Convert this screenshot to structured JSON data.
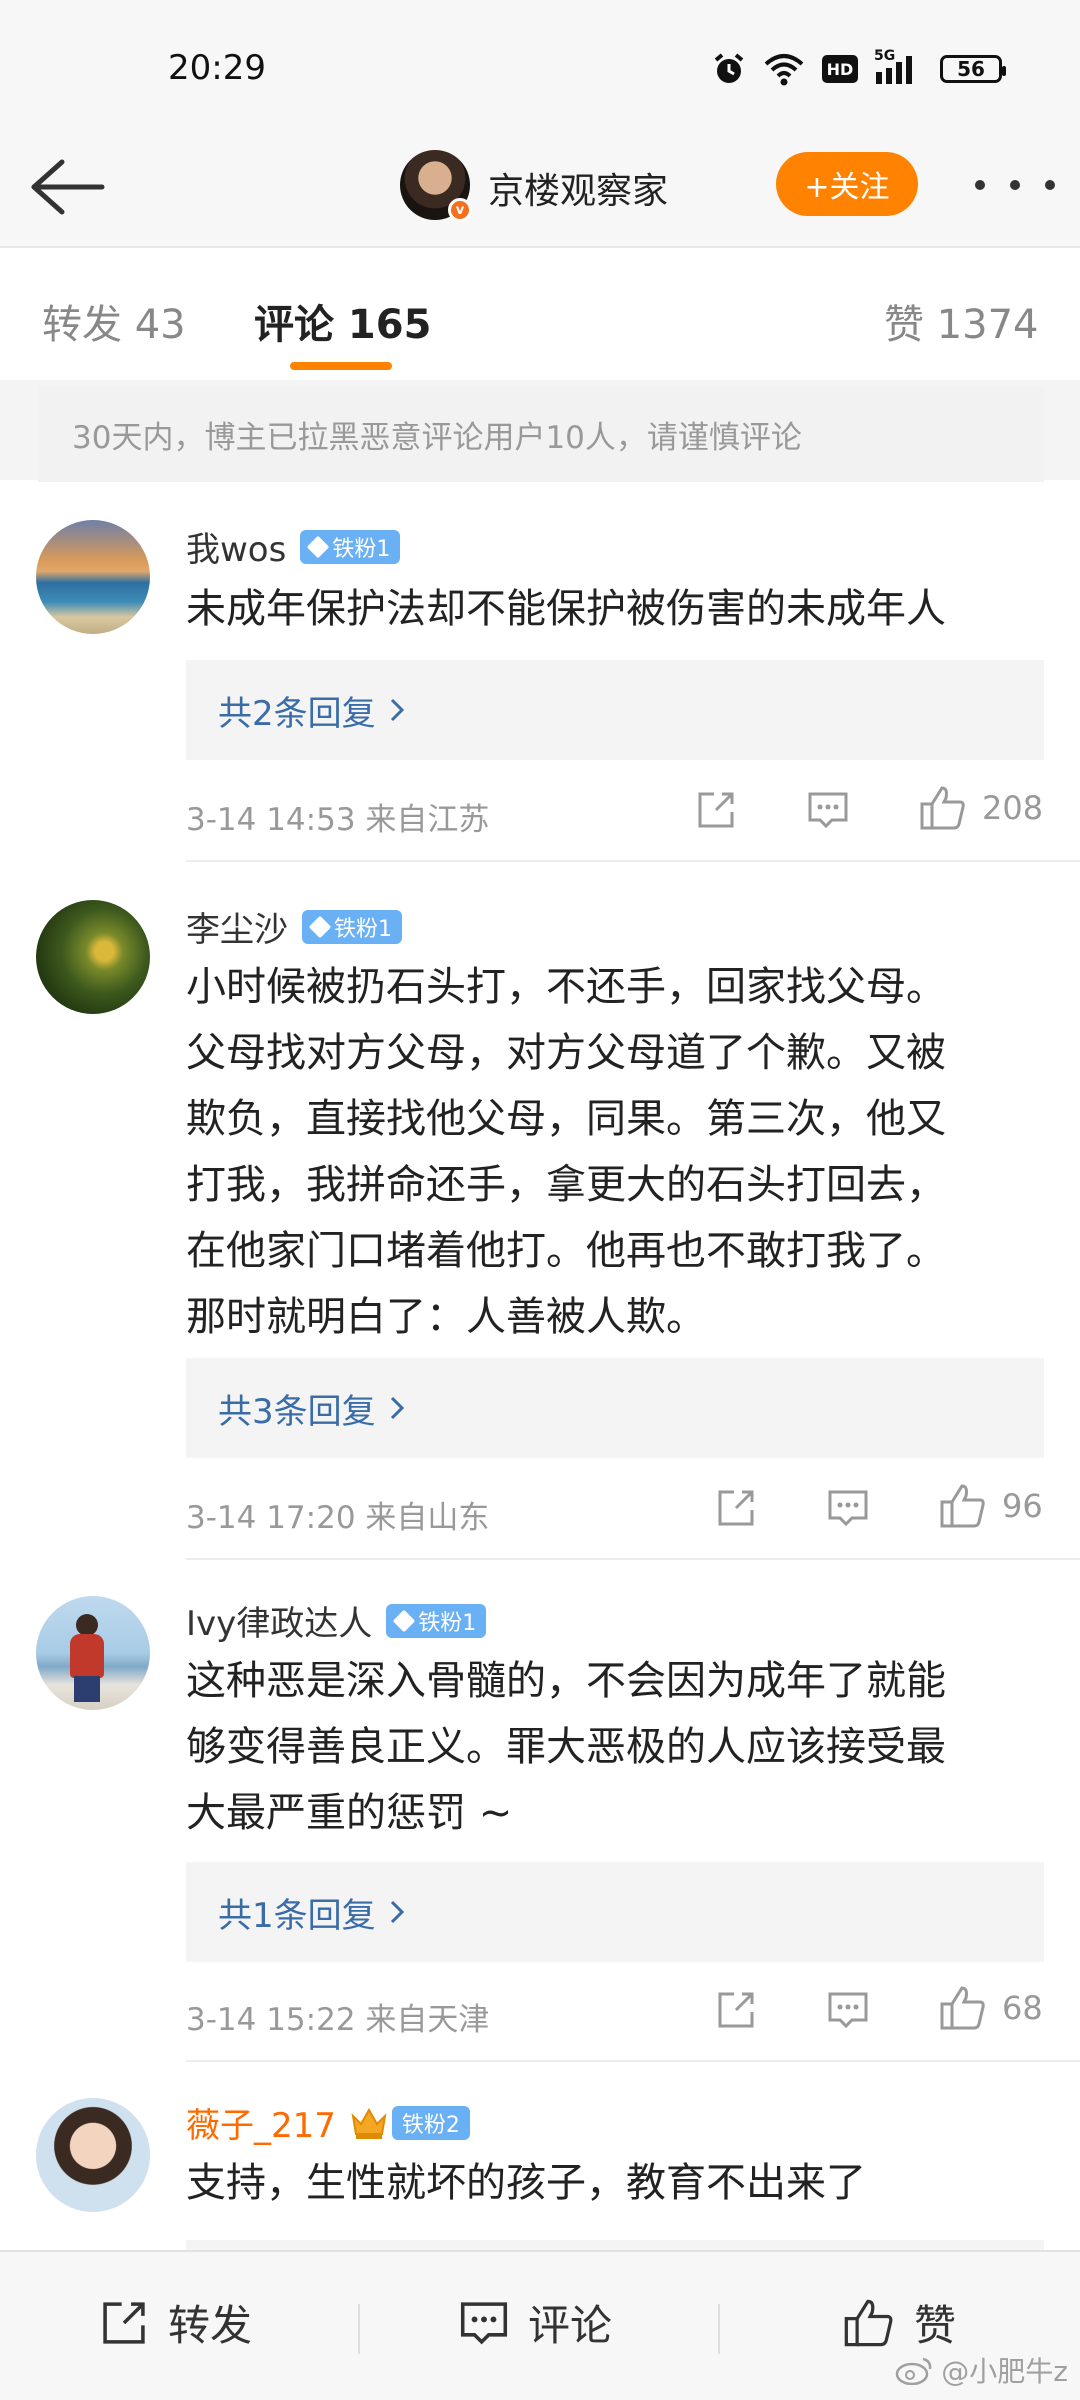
{
  "status": {
    "time": "20:29",
    "battery": "56",
    "hd": "HD",
    "network": "5G"
  },
  "header": {
    "author": "京楼观察家",
    "follow_label": "+关注"
  },
  "tabs": {
    "repost_label": "转发 43",
    "comment_label": "评论 165",
    "like_label": "赞 1374"
  },
  "notice": "30天内，博主已拉黑恶意评论用户10人，请谨慎评论",
  "comments": [
    {
      "name": "我wos",
      "badge": "铁粉1",
      "lines": [
        "未成年保护法却不能保护被伤害的未成年人"
      ],
      "replies": "共2条回复",
      "meta": "3-14 14:53  来自江苏",
      "likes": "208"
    },
    {
      "name": "李尘沙",
      "badge": "铁粉1",
      "lines": [
        "小时候被扔石头打，不还手，回家找父母。",
        "父母找对方父母，对方父母道了个歉。又被",
        "欺负，直接找他父母，同果。第三次，他又",
        "打我，我拼命还手，拿更大的石头打回去，",
        "在他家门口堵着他打。他再也不敢打我了。",
        "那时就明白了：人善被人欺。"
      ],
      "replies": "共3条回复",
      "meta": "3-14 17:20  来自山东",
      "likes": "96"
    },
    {
      "name": "Ivy律政达人",
      "badge": "铁粉1",
      "lines": [
        "这种恶是深入骨髓的，不会因为成年了就能",
        "够变得善良正义。罪大恶极的人应该接受最",
        "大最严重的惩罚 ~"
      ],
      "replies": "共1条回复",
      "meta": "3-14 15:22  来自天津",
      "likes": "68"
    },
    {
      "name": "薇子_217",
      "badge": "铁粉2",
      "lines": [
        "支持，生性就坏的孩子，教育不出来了"
      ]
    }
  ],
  "bottom": {
    "repost": "转发",
    "comment": "评论",
    "like": "赞"
  },
  "watermark": "@小肥牛z",
  "colors": {
    "accent": "#ff8200",
    "link": "#3a6da8",
    "badge": "#6ab0f5"
  }
}
